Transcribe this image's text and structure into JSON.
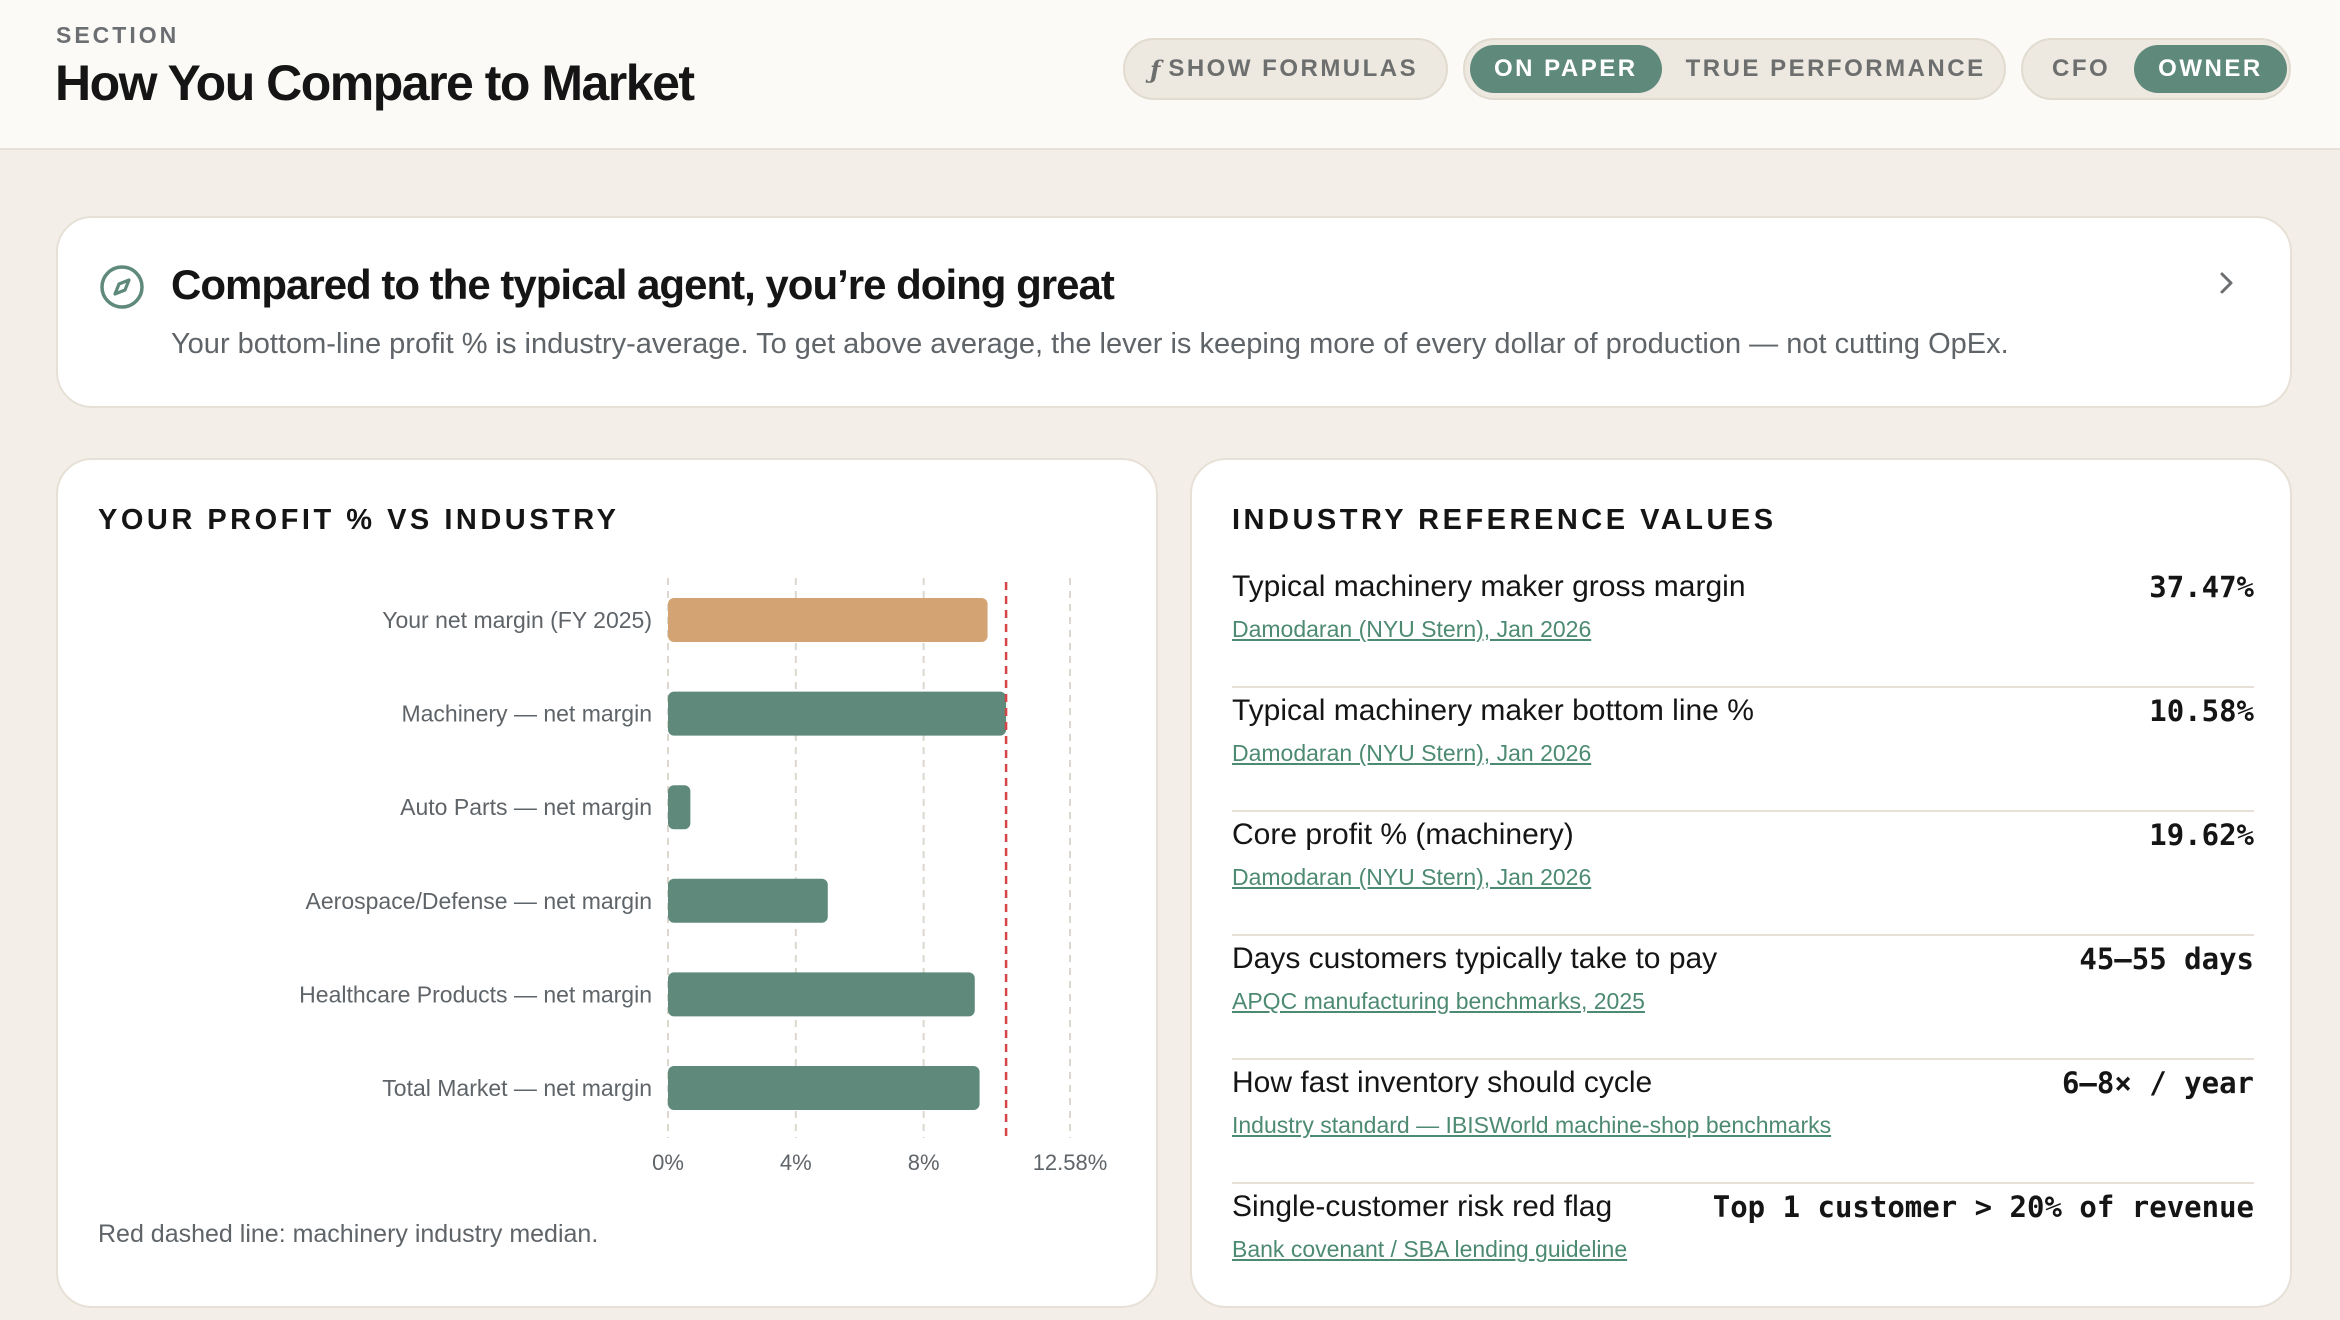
{
  "header": {
    "eyebrow": "SECTION",
    "title": "How You Compare to Market",
    "formulas_toggle": {
      "icon": "function-icon",
      "label": "SHOW FORMULAS"
    },
    "view_toggle": {
      "options": [
        "ON PAPER",
        "TRUE PERFORMANCE"
      ],
      "selected": "ON PAPER"
    },
    "role_toggle": {
      "options": [
        "CFO",
        "OWNER"
      ],
      "selected": "OWNER"
    }
  },
  "summary": {
    "icon": "compass-icon",
    "title": "Compared to the typical agent, you’re doing great",
    "text": "Your bottom-line profit % is industry-average. To get above average, the lever is keeping more of every dollar of production — not cutting OpEx.",
    "chevron": "chevron-right-icon"
  },
  "chart_card": {
    "heading": "YOUR PROFIT % VS INDUSTRY",
    "note": "Red dashed line: machinery industry median."
  },
  "chart_data": {
    "type": "bar",
    "orientation": "horizontal",
    "categories": [
      "Your net margin (FY 2025)",
      "Machinery — net margin",
      "Auto Parts — net margin",
      "Aerospace/Defense — net margin",
      "Healthcare Products — net margin",
      "Total Market — net margin"
    ],
    "values": [
      10.0,
      10.58,
      0.7,
      5.0,
      9.6,
      9.75
    ],
    "bar_colors": [
      "#d4a373",
      "#5f8a7b",
      "#5f8a7b",
      "#5f8a7b",
      "#5f8a7b",
      "#5f8a7b"
    ],
    "xticks": [
      0,
      4,
      8,
      12.58
    ],
    "xtick_labels": [
      "0%",
      "4%",
      "8%",
      "12.58%"
    ],
    "xlim": [
      0,
      12.58
    ],
    "reference_line": {
      "value": 10.58,
      "color": "#d64545",
      "style": "dashed"
    },
    "grid": "vertical dashed"
  },
  "ref_card": {
    "heading": "INDUSTRY REFERENCE VALUES",
    "rows": [
      {
        "label": "Typical machinery maker gross margin",
        "source": "Damodaran (NYU Stern), Jan 2026",
        "value": "37.47%"
      },
      {
        "label": "Typical machinery maker bottom line %",
        "source": "Damodaran (NYU Stern), Jan 2026",
        "value": "10.58%"
      },
      {
        "label": "Core profit % (machinery)",
        "source": "Damodaran (NYU Stern), Jan 2026",
        "value": "19.62%"
      },
      {
        "label": "Days customers typically take to pay",
        "source": "APQC manufacturing benchmarks, 2025",
        "value": "45–55 days"
      },
      {
        "label": "How fast inventory should cycle",
        "source": "Industry standard — IBISWorld machine-shop benchmarks",
        "value": "6–8× / year"
      },
      {
        "label": "Single-customer risk red flag",
        "source": "Bank covenant / SBA lending guideline",
        "value": "Top 1 customer > 20% of revenue"
      }
    ]
  },
  "colors": {
    "accent": "#5f8a7b",
    "highlight_bar": "#d4a373",
    "median_line": "#d64545",
    "link": "#4d8a72"
  }
}
